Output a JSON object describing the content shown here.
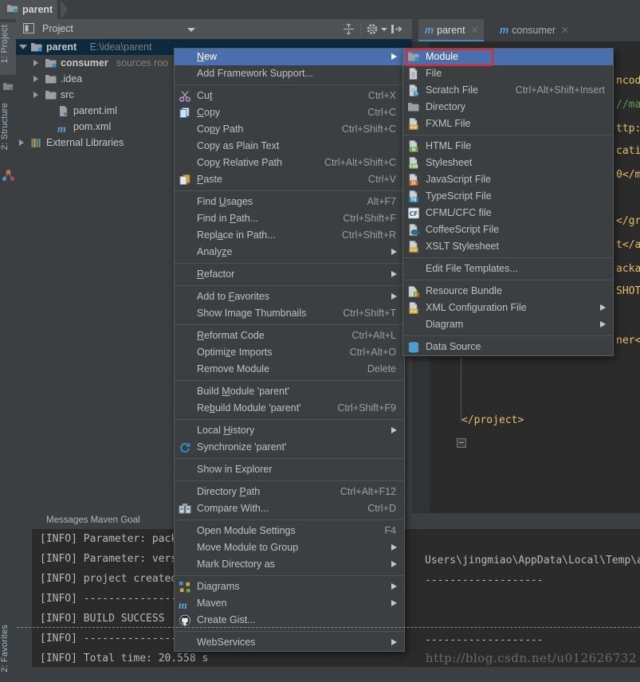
{
  "titlebar": {
    "breadcrumb": "parent"
  },
  "left_strip": {
    "project_tab": "1: Project",
    "structure_tab": "2: Structure",
    "favorites_tab": "2: Favorites"
  },
  "project_panel": {
    "title": "Project",
    "tree": [
      {
        "label": "parent",
        "sub": "E:\\idea\\parent",
        "indent": 14,
        "arrow": "open",
        "icon": "module-folder-icon",
        "bold": true,
        "selected": true
      },
      {
        "label": "consumer",
        "sub": "sources roo",
        "indent": 32,
        "arrow": "closed",
        "icon": "module-folder-icon",
        "bold": true,
        "selected": false
      },
      {
        "label": ".idea",
        "sub": "",
        "indent": 32,
        "arrow": "closed",
        "icon": "folder-icon",
        "bold": false,
        "selected": false
      },
      {
        "label": "src",
        "sub": "",
        "indent": 32,
        "arrow": "closed",
        "icon": "folder-icon",
        "bold": false,
        "selected": false
      },
      {
        "label": "parent.iml",
        "sub": "",
        "indent": 48,
        "arrow": "none",
        "icon": "iml-file-icon",
        "bold": false,
        "selected": false
      },
      {
        "label": "pom.xml",
        "sub": "",
        "indent": 48,
        "arrow": "none",
        "icon": "maven-m-icon",
        "bold": false,
        "selected": false
      },
      {
        "label": "External Libraries",
        "sub": "",
        "indent": 14,
        "arrow": "closed",
        "icon": "libraries-icon",
        "bold": false,
        "selected": false
      }
    ]
  },
  "editor": {
    "tabs": [
      {
        "label": "parent",
        "icon": "maven-m-icon",
        "active": true
      },
      {
        "label": "consumer",
        "icon": "maven-m-icon",
        "active": false
      }
    ],
    "visible_code": "</project>",
    "right_edge_fragments": [
      "ncodi",
      "//mav",
      "ttp:/",
      "catio",
      "0</m",
      "</gro",
      "t</ar",
      "ackag",
      "SHOT<",
      "ner</"
    ]
  },
  "messages_panel": {
    "title": "Messages Maven Goal",
    "lines": [
      "[INFO] Parameter: packa",
      "[INFO] Parameter: versi",
      "[INFO] project created ",
      "[INFO] -----------------",
      "[INFO] BUILD SUCCESS",
      "[INFO] -----------------",
      "[INFO] Total time: 20.558 s"
    ],
    "right_lines": [
      "Users\\jingmiao\\AppData\\Local\\Temp\\arc",
      "-------------------",
      "",
      "-------------------"
    ],
    "watermark": "http://blog.csdn.net/u012626732"
  },
  "context_menu": {
    "items": [
      {
        "label": "New",
        "accel": "",
        "icon": "",
        "submenu": true,
        "highlighted": true,
        "mnemonic": 0
      },
      {
        "label": "Add Framework Support...",
        "accel": "",
        "icon": "",
        "submenu": false,
        "highlighted": false,
        "mnemonic": -1
      },
      {
        "separator": true
      },
      {
        "label": "Cut",
        "accel": "Ctrl+X",
        "icon": "scissors-icon",
        "submenu": false,
        "highlighted": false,
        "mnemonic": 2
      },
      {
        "label": "Copy",
        "accel": "Ctrl+C",
        "icon": "copy-icon",
        "submenu": false,
        "highlighted": false,
        "mnemonic": 0
      },
      {
        "label": "Copy Path",
        "accel": "Ctrl+Shift+C",
        "icon": "",
        "submenu": false,
        "highlighted": false,
        "mnemonic": 2
      },
      {
        "label": "Copy as Plain Text",
        "accel": "",
        "icon": "",
        "submenu": false,
        "highlighted": false,
        "mnemonic": -1
      },
      {
        "label": "Copy Relative Path",
        "accel": "Ctrl+Alt+Shift+C",
        "icon": "",
        "submenu": false,
        "highlighted": false,
        "mnemonic": 3
      },
      {
        "label": "Paste",
        "accel": "Ctrl+V",
        "icon": "paste-icon",
        "submenu": false,
        "highlighted": false,
        "mnemonic": 0
      },
      {
        "separator": true
      },
      {
        "label": "Find Usages",
        "accel": "Alt+F7",
        "icon": "",
        "submenu": false,
        "highlighted": false,
        "mnemonic": 5
      },
      {
        "label": "Find in Path...",
        "accel": "Ctrl+Shift+F",
        "icon": "",
        "submenu": false,
        "highlighted": false,
        "mnemonic": 8
      },
      {
        "label": "Replace in Path...",
        "accel": "Ctrl+Shift+R",
        "icon": "",
        "submenu": false,
        "highlighted": false,
        "mnemonic": 4
      },
      {
        "label": "Analyze",
        "accel": "",
        "icon": "",
        "submenu": true,
        "highlighted": false,
        "mnemonic": 5
      },
      {
        "separator": true
      },
      {
        "label": "Refactor",
        "accel": "",
        "icon": "",
        "submenu": true,
        "highlighted": false,
        "mnemonic": 0
      },
      {
        "separator": true
      },
      {
        "label": "Add to Favorites",
        "accel": "",
        "icon": "",
        "submenu": true,
        "highlighted": false,
        "mnemonic": 7
      },
      {
        "label": "Show Image Thumbnails",
        "accel": "Ctrl+Shift+T",
        "icon": "",
        "submenu": false,
        "highlighted": false,
        "mnemonic": -1
      },
      {
        "separator": true
      },
      {
        "label": "Reformat Code",
        "accel": "Ctrl+Alt+L",
        "icon": "",
        "submenu": false,
        "highlighted": false,
        "mnemonic": 0
      },
      {
        "label": "Optimize Imports",
        "accel": "Ctrl+Alt+O",
        "icon": "",
        "submenu": false,
        "highlighted": false,
        "mnemonic": 6
      },
      {
        "label": "Remove Module",
        "accel": "Delete",
        "icon": "",
        "submenu": false,
        "highlighted": false,
        "mnemonic": -1
      },
      {
        "separator": true
      },
      {
        "label": "Build Module 'parent'",
        "accel": "",
        "icon": "",
        "submenu": false,
        "highlighted": false,
        "mnemonic": 6
      },
      {
        "label": "Rebuild Module 'parent'",
        "accel": "Ctrl+Shift+F9",
        "icon": "",
        "submenu": false,
        "highlighted": false,
        "mnemonic": 2
      },
      {
        "separator": true
      },
      {
        "label": "Local History",
        "accel": "",
        "icon": "",
        "submenu": true,
        "highlighted": false,
        "mnemonic": 6
      },
      {
        "label": "Synchronize 'parent'",
        "accel": "",
        "icon": "sync-icon",
        "submenu": false,
        "highlighted": false,
        "mnemonic": -1
      },
      {
        "separator": true
      },
      {
        "label": "Show in Explorer",
        "accel": "",
        "icon": "",
        "submenu": false,
        "highlighted": false,
        "mnemonic": -1
      },
      {
        "separator": true
      },
      {
        "label": "Directory Path",
        "accel": "Ctrl+Alt+F12",
        "icon": "",
        "submenu": false,
        "highlighted": false,
        "mnemonic": 10
      },
      {
        "label": "Compare With...",
        "accel": "Ctrl+D",
        "icon": "compare-icon",
        "submenu": false,
        "highlighted": false,
        "mnemonic": -1
      },
      {
        "separator": true
      },
      {
        "label": "Open Module Settings",
        "accel": "F4",
        "icon": "",
        "submenu": false,
        "highlighted": false,
        "mnemonic": -1
      },
      {
        "label": "Move Module to Group",
        "accel": "",
        "icon": "",
        "submenu": true,
        "highlighted": false,
        "mnemonic": -1
      },
      {
        "label": "Mark Directory as",
        "accel": "",
        "icon": "",
        "submenu": true,
        "highlighted": false,
        "mnemonic": -1
      },
      {
        "separator": true
      },
      {
        "label": "Diagrams",
        "accel": "",
        "icon": "diagrams-icon",
        "submenu": true,
        "highlighted": false,
        "mnemonic": -1
      },
      {
        "label": "Maven",
        "accel": "",
        "icon": "maven-m-icon",
        "submenu": true,
        "highlighted": false,
        "mnemonic": -1
      },
      {
        "label": "Create Gist...",
        "accel": "",
        "icon": "github-icon",
        "submenu": false,
        "highlighted": false,
        "mnemonic": -1
      },
      {
        "separator": true
      },
      {
        "label": "WebServices",
        "accel": "",
        "icon": "",
        "submenu": true,
        "highlighted": false,
        "mnemonic": -1
      }
    ]
  },
  "new_submenu": {
    "highlight_color": "#4b6eaf",
    "focus_ring_color": "#ee2222",
    "items": [
      {
        "label": "Module",
        "accel": "",
        "icon": "module-folder-icon",
        "submenu": false,
        "highlighted": true
      },
      {
        "label": "File",
        "accel": "",
        "icon": "file-icon",
        "submenu": false,
        "highlighted": false
      },
      {
        "label": "Scratch File",
        "accel": "Ctrl+Alt+Shift+Insert",
        "icon": "scratch-file-icon",
        "submenu": false,
        "highlighted": false
      },
      {
        "label": "Directory",
        "accel": "",
        "icon": "folder-icon",
        "submenu": false,
        "highlighted": false
      },
      {
        "label": "FXML File",
        "accel": "",
        "icon": "fxml-file-icon",
        "submenu": false,
        "highlighted": false
      },
      {
        "separator": true
      },
      {
        "label": "HTML File",
        "accel": "",
        "icon": "html-file-icon",
        "submenu": false,
        "highlighted": false
      },
      {
        "label": "Stylesheet",
        "accel": "",
        "icon": "css-file-icon",
        "submenu": false,
        "highlighted": false
      },
      {
        "label": "JavaScript File",
        "accel": "",
        "icon": "js-file-icon",
        "submenu": false,
        "highlighted": false
      },
      {
        "label": "TypeScript File",
        "accel": "",
        "icon": "ts-file-icon",
        "submenu": false,
        "highlighted": false
      },
      {
        "label": "CFML/CFC file",
        "accel": "",
        "icon": "cfml-file-icon",
        "submenu": false,
        "highlighted": false
      },
      {
        "label": "CoffeeScript File",
        "accel": "",
        "icon": "coffee-file-icon",
        "submenu": false,
        "highlighted": false
      },
      {
        "label": "XSLT Stylesheet",
        "accel": "",
        "icon": "xslt-file-icon",
        "submenu": false,
        "highlighted": false
      },
      {
        "separator": true
      },
      {
        "label": "Edit File Templates...",
        "accel": "",
        "icon": "",
        "submenu": false,
        "highlighted": false
      },
      {
        "separator": true
      },
      {
        "label": "Resource Bundle",
        "accel": "",
        "icon": "resource-bundle-icon",
        "submenu": false,
        "highlighted": false
      },
      {
        "label": "XML Configuration File",
        "accel": "",
        "icon": "xml-file-icon",
        "submenu": true,
        "highlighted": false
      },
      {
        "label": "Diagram",
        "accel": "",
        "icon": "",
        "submenu": true,
        "highlighted": false
      },
      {
        "separator": true
      },
      {
        "label": "Data Source",
        "accel": "",
        "icon": "data-source-icon",
        "submenu": false,
        "highlighted": false
      }
    ]
  },
  "colors": {
    "window_bg": "#3c3f41",
    "editor_bg": "#2b2b2b",
    "menu_bg": "#3c3f41",
    "menu_highlight": "#4b6eaf",
    "tree_selection": "#0d293e",
    "accent_blue": "#4a88c7",
    "code_tag": "#e8bf6a"
  }
}
